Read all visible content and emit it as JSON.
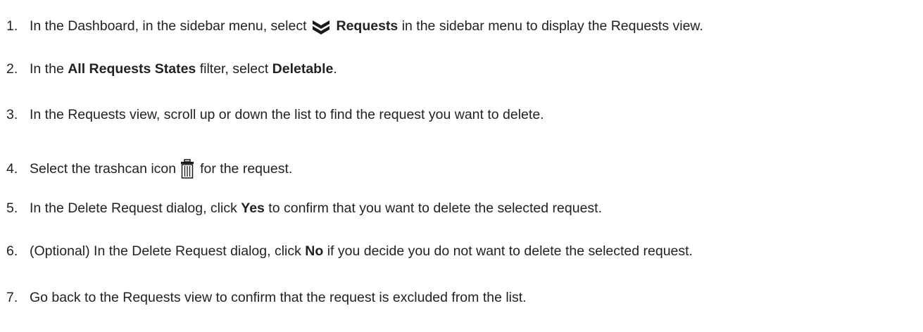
{
  "colors": {
    "text": "#222222",
    "icon": "#1a1a1a"
  },
  "steps": [
    {
      "number": "1.",
      "before": "In the Dashboard, in the sidebar menu, select",
      "icon": "layers-stack-icon",
      "bold": "Requests",
      "after": " in the sidebar menu to display the Requests view."
    },
    {
      "number": "2.",
      "before": "In the ",
      "bold": "All Requests States",
      "middle": " filter, select ",
      "bold2": "Deletable",
      "after": "."
    },
    {
      "number": "3.",
      "text": "In the Requests view, scroll up or down the list to find the request you want to delete."
    },
    {
      "number": "4.",
      "before": "Select the trashcan icon",
      "icon": "trashcan-icon",
      "after": "for the request."
    },
    {
      "number": "5.",
      "before": "In the Delete Request dialog, click ",
      "bold": "Yes",
      "after": " to confirm that you want to delete the selected request."
    },
    {
      "number": "6.",
      "before": "(Optional) In the Delete Request dialog, click ",
      "bold": "No",
      "after": " if you decide you do not want to delete the selected request."
    },
    {
      "number": "7.",
      "text": "Go back to the Requests view to confirm that the request is excluded from the list."
    }
  ]
}
